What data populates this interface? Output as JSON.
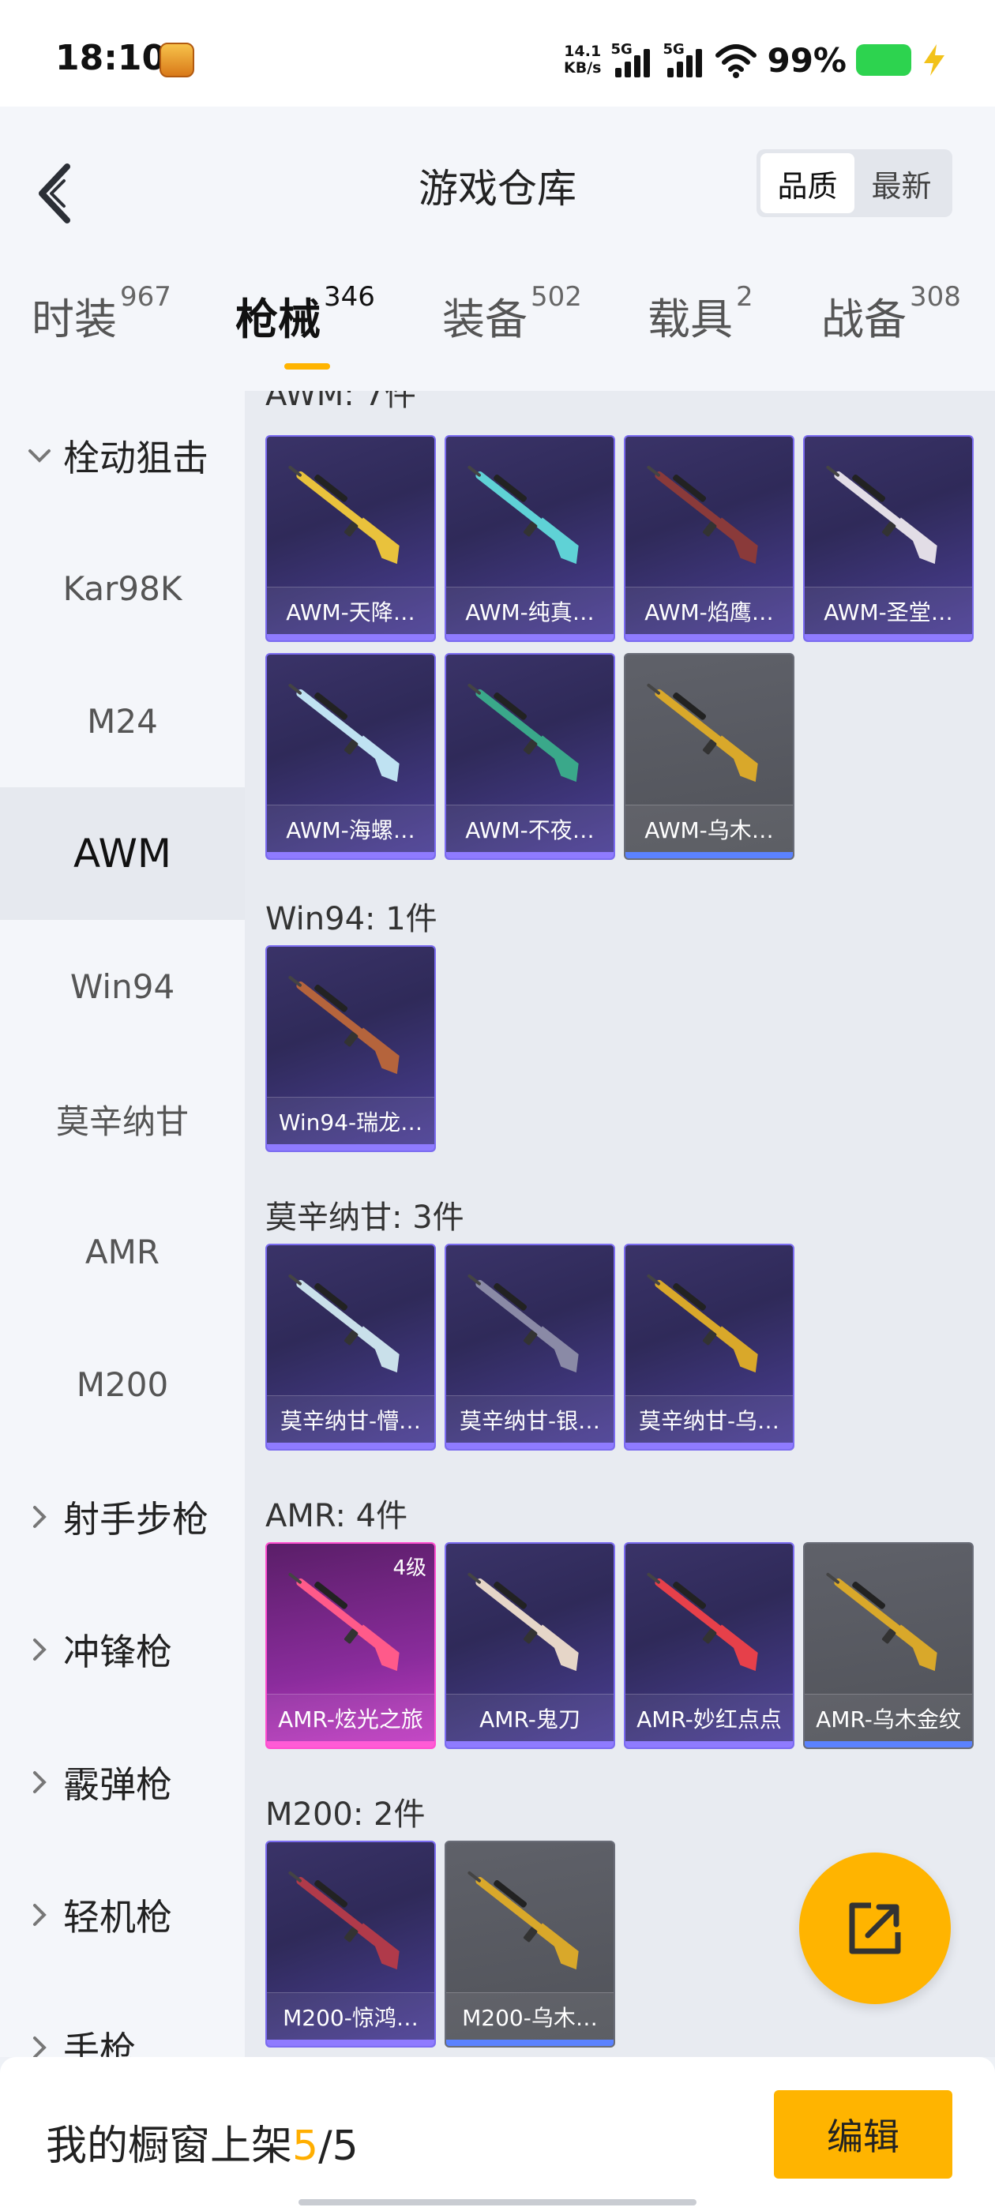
{
  "status_bar": {
    "time": "18:10",
    "net_speed_value": "14.1",
    "net_speed_unit": "KB/s",
    "signal1_label": "5G",
    "signal2_label": "5G",
    "battery_text": "99%",
    "battery_color": "#2dd34f"
  },
  "header": {
    "back_icon": "chevron-left-icon",
    "title": "游戏仓库",
    "sort_options": [
      "品质",
      "最新"
    ],
    "sort_selected": "品质"
  },
  "category_tabs": [
    {
      "name": "时装",
      "count": "967"
    },
    {
      "name": "枪械",
      "count": "346"
    },
    {
      "name": "装备",
      "count": "502"
    },
    {
      "name": "载具",
      "count": "2"
    },
    {
      "name": "战备",
      "count": "308"
    }
  ],
  "category_active": "枪械",
  "accent_color": "#ffb400",
  "sidebar": {
    "items": [
      {
        "label": "栓动狙击",
        "type": "group",
        "expanded": true
      },
      {
        "label": "Kar98K",
        "type": "sub"
      },
      {
        "label": "M24",
        "type": "sub"
      },
      {
        "label": "AWM",
        "type": "sub",
        "active": true
      },
      {
        "label": "Win94",
        "type": "sub"
      },
      {
        "label": "莫辛纳甘",
        "type": "sub"
      },
      {
        "label": "AMR",
        "type": "sub"
      },
      {
        "label": "M200",
        "type": "sub"
      },
      {
        "label": "射手步枪",
        "type": "group"
      },
      {
        "label": "冲锋枪",
        "type": "group"
      },
      {
        "label": "霰弹枪",
        "type": "group"
      },
      {
        "label": "轻机枪",
        "type": "group"
      },
      {
        "label": "手枪",
        "type": "group"
      }
    ]
  },
  "sections": [
    {
      "title": "AWM: 7件",
      "items": [
        {
          "label": "AWM-天降…",
          "rarity": "purple",
          "gun_color": "#e9c23c"
        },
        {
          "label": "AWM-纯真…",
          "rarity": "purple",
          "gun_color": "#5fd2d6"
        },
        {
          "label": "AWM-焰鹰…",
          "rarity": "purple",
          "gun_color": "#8a3a3a"
        },
        {
          "label": "AWM-圣堂…",
          "rarity": "purple",
          "gun_color": "#e2dde6"
        },
        {
          "label": "AWM-海螺…",
          "rarity": "purple",
          "gun_color": "#bfe2f2"
        },
        {
          "label": "AWM-不夜…",
          "rarity": "purple",
          "gun_color": "#3aa88a"
        },
        {
          "label": "AWM-乌木…",
          "rarity": "grey",
          "gun_color": "#d9a82a"
        }
      ]
    },
    {
      "title": "Win94: 1件",
      "items": [
        {
          "label": "Win94-瑞龙…",
          "rarity": "purple",
          "gun_color": "#b5643c"
        }
      ]
    },
    {
      "title": "莫辛纳甘: 3件",
      "items": [
        {
          "label": "莫辛纳甘-懵…",
          "rarity": "purple",
          "gun_color": "#c9e0ea"
        },
        {
          "label": "莫辛纳甘-银…",
          "rarity": "purple",
          "gun_color": "#8a8aa6"
        },
        {
          "label": "莫辛纳甘-乌…",
          "rarity": "purple",
          "gun_color": "#d9a82a"
        }
      ]
    },
    {
      "title": "AMR: 4件",
      "items": [
        {
          "label": "AMR-炫光之旅",
          "rarity": "pink",
          "gun_color": "#ff5a8a",
          "tier": "4级"
        },
        {
          "label": "AMR-鬼刀",
          "rarity": "purple",
          "gun_color": "#e6d6c8"
        },
        {
          "label": "AMR-妙红点点",
          "rarity": "purple",
          "gun_color": "#e6404a"
        },
        {
          "label": "AMR-乌木金纹",
          "rarity": "grey",
          "gun_color": "#d9a82a"
        }
      ]
    },
    {
      "title": "M200: 2件",
      "items": [
        {
          "label": "M200-惊鸿…",
          "rarity": "purple",
          "gun_color": "#b03a4a"
        },
        {
          "label": "M200-乌木…",
          "rarity": "grey",
          "gun_color": "#d9a82a"
        }
      ]
    }
  ],
  "top_partial_title": "AWM: 7件",
  "fab_icon": "share-external-icon",
  "bottom_bar": {
    "label": "我的橱窗上架",
    "current": "5",
    "separator": "/",
    "total": "5",
    "edit_label": "编辑"
  }
}
